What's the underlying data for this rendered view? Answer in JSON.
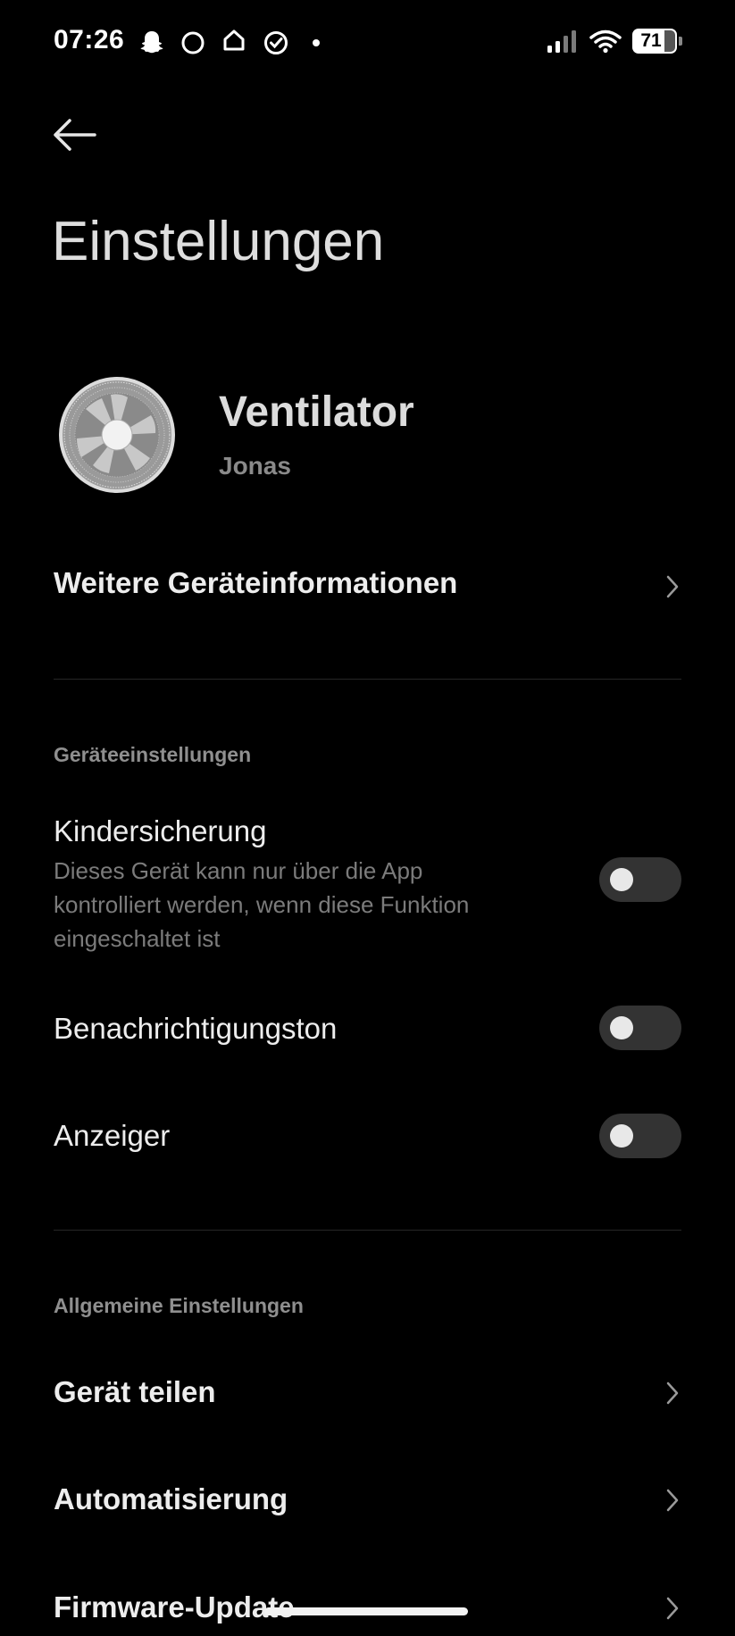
{
  "status_bar": {
    "time": "07:26",
    "notification_icons": [
      "snapchat-icon",
      "circle-icon",
      "home-icon",
      "check-circle-icon",
      "dot-icon"
    ],
    "battery_level": "71",
    "signal_icon": "signal-icon",
    "wifi_icon": "wifi-icon"
  },
  "header": {
    "back_icon": "back-arrow-icon",
    "title": "Einstellungen"
  },
  "device": {
    "name": "Ventilator",
    "owner": "Jonas",
    "image_icon": "fan-icon"
  },
  "more_info": {
    "label": "Weitere Geräteinformationen"
  },
  "device_settings": {
    "section_title": "Geräteeinstellungen",
    "items": [
      {
        "label": "Kindersicherung",
        "description": "Dieses Gerät kann nur über die App kontrolliert werden, wenn diese Funktion eingeschaltet ist",
        "enabled": false
      },
      {
        "label": "Benachrichtigungston",
        "enabled": false
      },
      {
        "label": "Anzeiger",
        "enabled": false
      }
    ]
  },
  "general_settings": {
    "section_title": "Allgemeine Einstellungen",
    "items": [
      {
        "label": "Gerät teilen"
      },
      {
        "label": "Automatisierung"
      },
      {
        "label": "Firmware-Update"
      }
    ]
  },
  "colors": {
    "background": "#000000",
    "toggle_off": "#333333",
    "section_text": "#8f8f8f"
  }
}
